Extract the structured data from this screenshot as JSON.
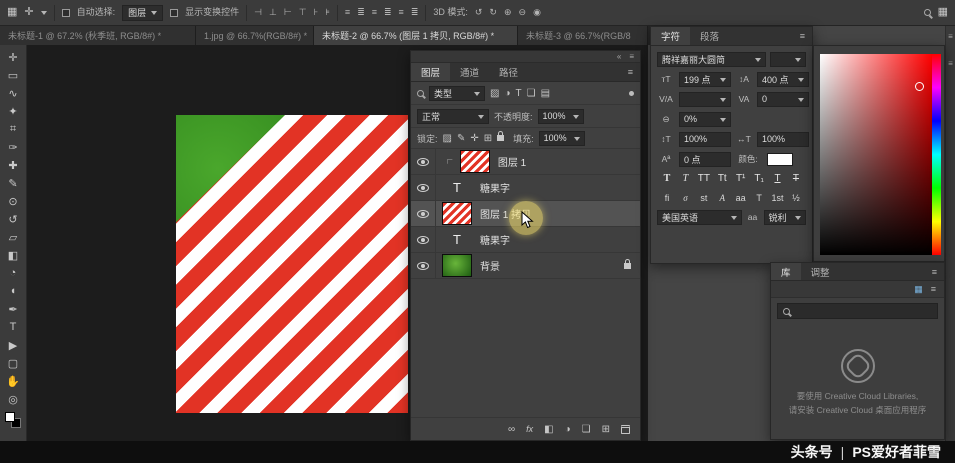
{
  "options_bar": {
    "auto_select_label": "自动选择:",
    "auto_select_value": "图层",
    "show_transform_label": "显示变换控件",
    "mode_3d_label": "3D 模式:"
  },
  "tabs": [
    {
      "label": "未标题-1 @ 67.2% (秋季班, RGB/8#) *"
    },
    {
      "label": "1.jpg @ 66.7%(RGB/8#) *"
    },
    {
      "label": "未标题-2 @ 66.7% (图层 1 拷贝, RGB/8#) *"
    },
    {
      "label": "未标题-3 @ 66.7%(RGB/8"
    }
  ],
  "layers_panel": {
    "tabs": [
      "图层",
      "通道",
      "路径"
    ],
    "filter_type_label": "类型",
    "blend_mode": "正常",
    "opacity_label": "不透明度:",
    "opacity_value": "100%",
    "lock_label": "锁定:",
    "fill_label": "填充:",
    "fill_value": "100%",
    "layers": [
      {
        "name": "图层 1"
      },
      {
        "name": "糖果字"
      },
      {
        "name": "图层 1 拷贝"
      },
      {
        "name": "糖果字"
      },
      {
        "name": "背景"
      }
    ]
  },
  "character_panel": {
    "tabs": [
      "字符",
      "段落"
    ],
    "font_family": "腾祥嘉丽大圆简",
    "font_style": "",
    "font_size": "199 点",
    "leading": "400 点",
    "kerning": "",
    "tracking": "0",
    "tsume": "0%",
    "vertical_scale": "100%",
    "horizontal_scale": "100%",
    "baseline_shift": "0 点",
    "color_label": "颜色:",
    "style_buttons": [
      "T",
      "T",
      "TT",
      "Tt",
      "T¹",
      "T₁",
      "T",
      "T"
    ],
    "opentype_buttons": [
      "fi",
      "σ",
      "st",
      "A",
      "aa",
      "T",
      "1st",
      "½"
    ],
    "language": "美国英语",
    "anti_alias_icon": "aa",
    "anti_alias": "锐利"
  },
  "libraries_panel": {
    "tabs": [
      "库",
      "调整"
    ],
    "message_line1": "要使用 Creative Cloud Libraries,",
    "message_line2": "请安装 Creative Cloud 桌面应用程序"
  },
  "watermark": {
    "brand": "头条号",
    "divider": "|",
    "name": "PS爱好者菲雪"
  },
  "icons": {
    "app_grid": "▦",
    "move_tool": "✛",
    "workspace": "▦",
    "panel_menu": "≡",
    "collapse": "«",
    "clip": "∟",
    "text_thumb": "T",
    "tools": [
      "✛",
      "▭",
      "∿",
      "✦",
      "⌗",
      "✑",
      "✚",
      "✎",
      "⊙",
      "↺",
      "▱",
      "◧",
      "◔",
      "◖",
      "✒",
      "T",
      "▶",
      "▢",
      "✋",
      "◎"
    ],
    "align": [
      "⊣",
      "⊥",
      "⊢",
      "⊤",
      "⊦",
      "⊧"
    ],
    "distribute": [
      "≡",
      "≣",
      "≡",
      "≣",
      "≡",
      "≣"
    ],
    "mode_3d": [
      "↺",
      "↻",
      "⊕",
      "⊖",
      "◉"
    ],
    "filter_kinds": [
      "▨",
      "◑",
      "T",
      "❏",
      "▤"
    ],
    "locks": [
      "▨",
      "✎",
      "✛",
      "⊞"
    ],
    "layer_bottom_link": "∞",
    "layer_bottom_fx": "fx",
    "layer_bottom_mask": "◧",
    "layer_bottom_adjust": "◑",
    "layer_bottom_group": "❏",
    "layer_bottom_new": "⊞",
    "char": {
      "size": "тT",
      "leading": "↕A",
      "kerning": "V/A",
      "tracking": "VA",
      "tsume": "⊖",
      "vscale": "↕T",
      "hscale": "↔T",
      "baseline": "Aª"
    }
  }
}
